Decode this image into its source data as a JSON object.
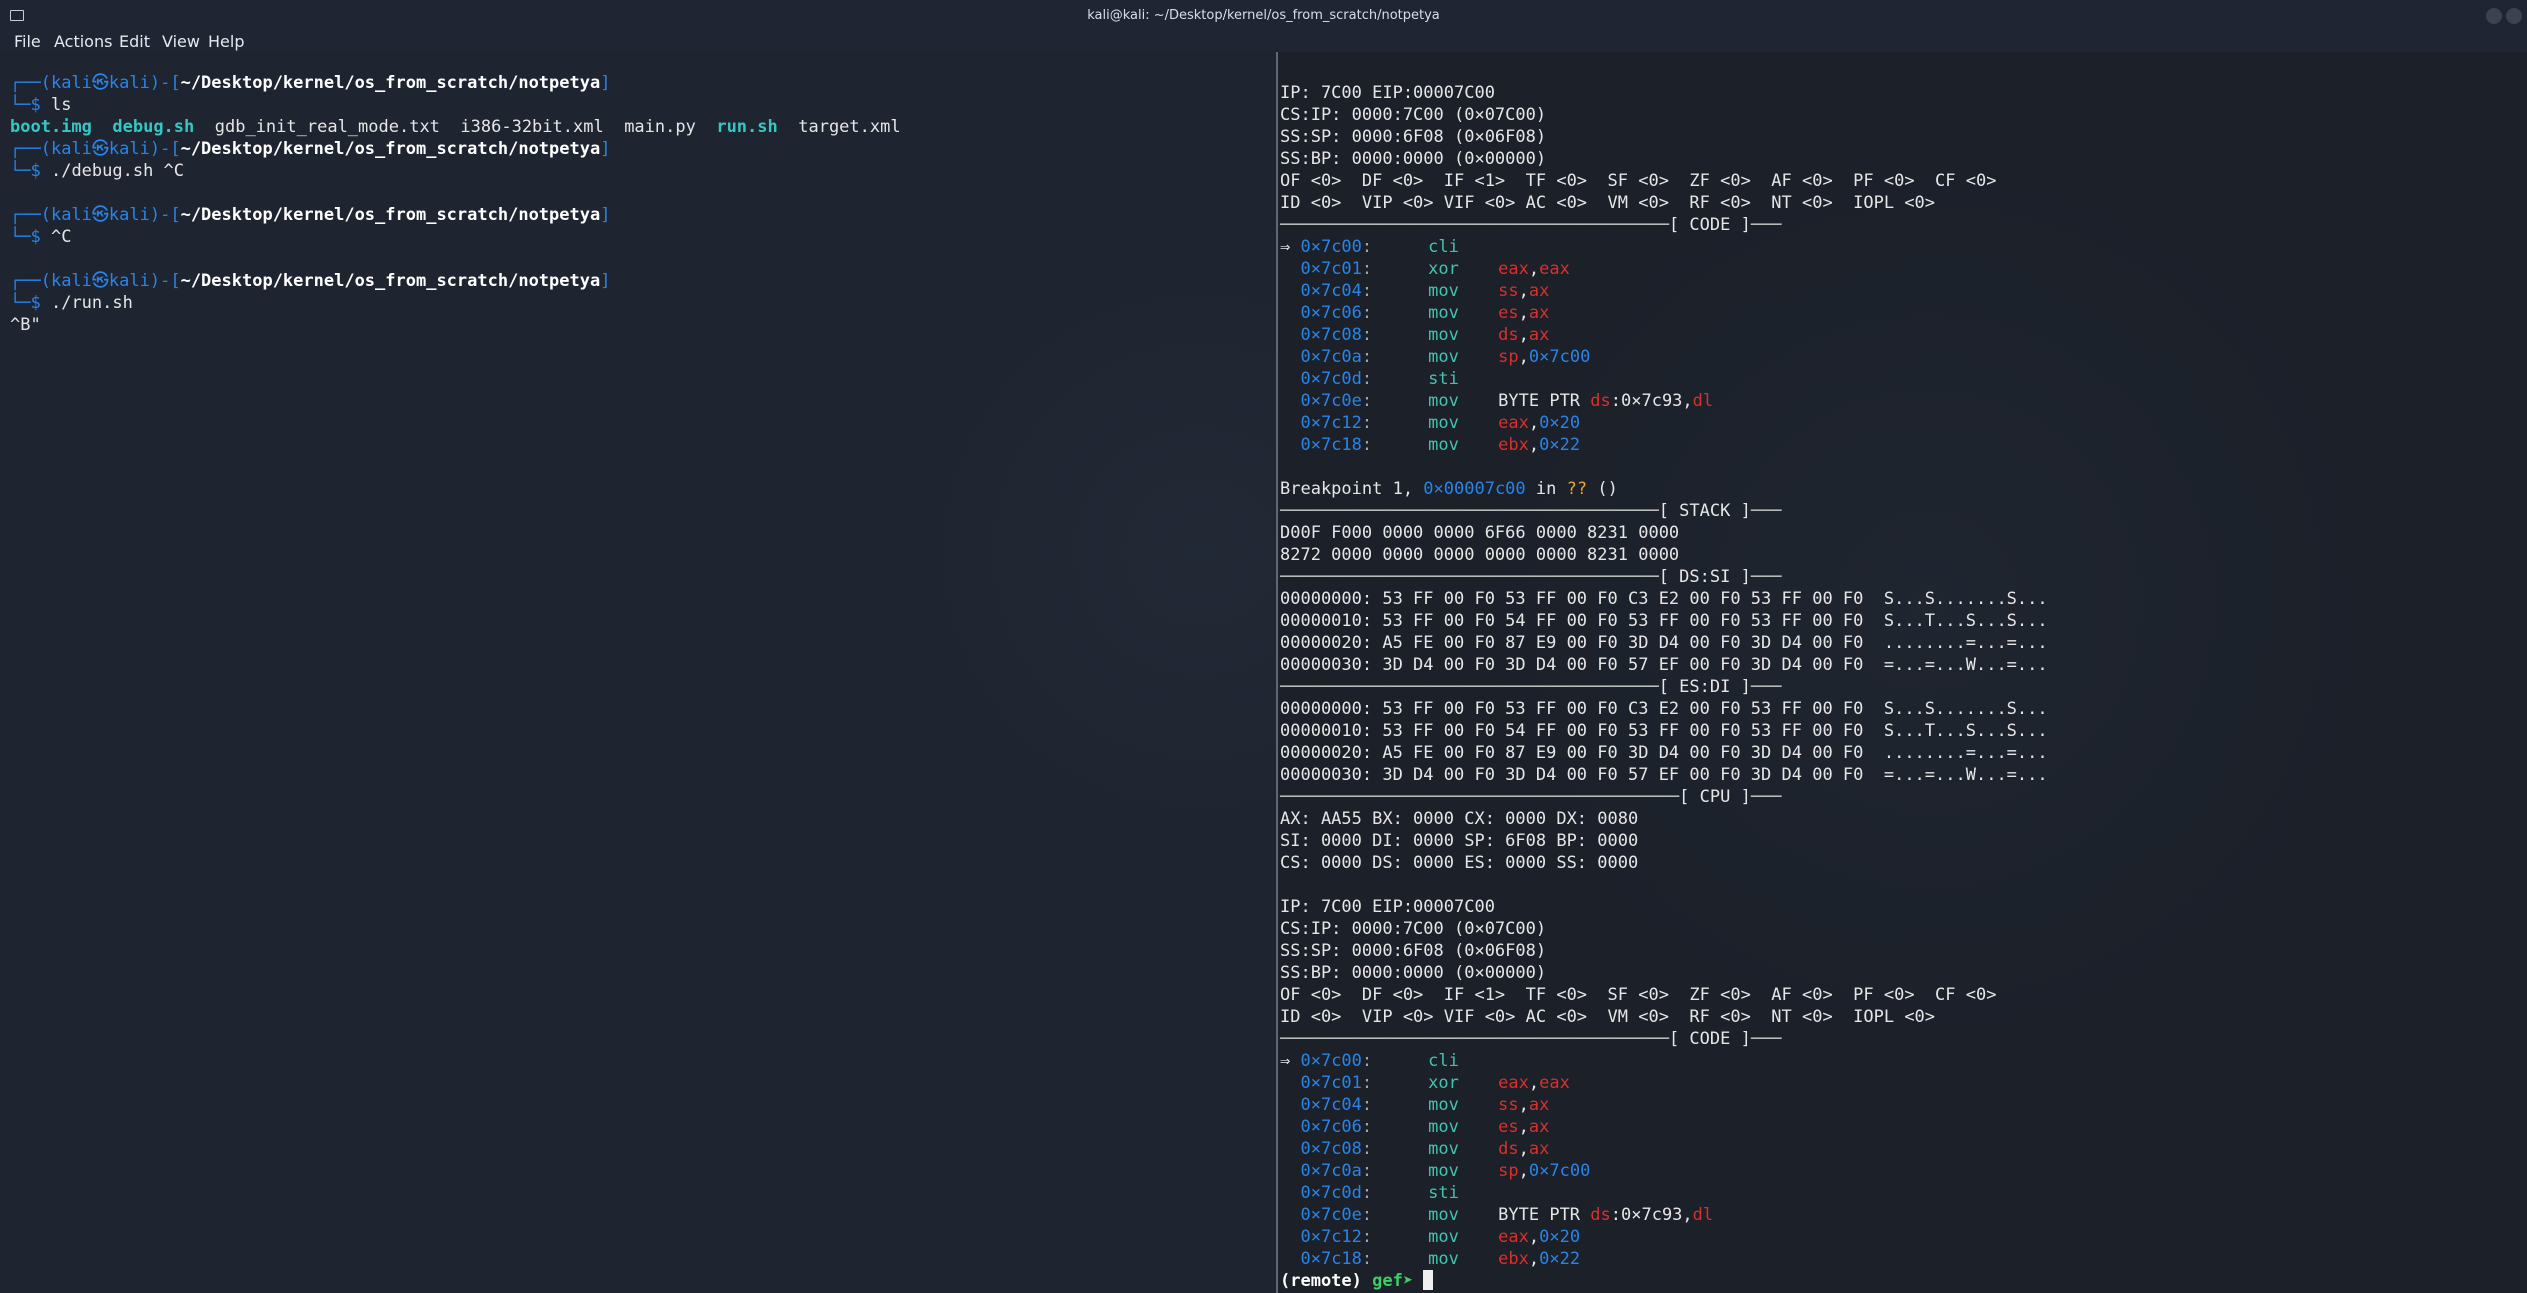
{
  "window": {
    "title": "kali@kali: ~/Desktop/kernel/os_from_scratch/notpetya"
  },
  "menu": [
    "File",
    "Actions",
    "Edit",
    "View",
    "Help"
  ],
  "left": {
    "prompt_user": "kali",
    "prompt_host": "kali",
    "prompt_at": "㉿",
    "prompt_path": "~/Desktop/kernel/os_from_scratch/notpetya",
    "blocks": [
      {
        "cmd": "ls"
      },
      {
        "cmd": "./debug.sh ^C"
      },
      {
        "cmd": "^C"
      },
      {
        "cmd": "./run.sh"
      }
    ],
    "ls_output": [
      {
        "name": "boot.img",
        "kind": "exec"
      },
      {
        "name": "debug.sh",
        "kind": "exec"
      },
      {
        "name": "gdb_init_real_mode.txt",
        "kind": "file"
      },
      {
        "name": "i386-32bit.xml",
        "kind": "file"
      },
      {
        "name": "main.py",
        "kind": "file"
      },
      {
        "name": "run.sh",
        "kind": "exec"
      },
      {
        "name": "target.xml",
        "kind": "file"
      }
    ],
    "run_output": "^B\""
  },
  "right": {
    "regs": {
      "ip": "IP: 7C00 EIP:00007C00",
      "csip": "CS:IP: 0000:7C00 (0×07C00)",
      "sssp": "SS:SP: 0000:6F08 (0×06F08)",
      "ssbp": "SS:BP: 0000:0000 (0×00000)",
      "flags1": "OF <0>  DF <0>  IF <1>  TF <0>  SF <0>  ZF <0>  AF <0>  PF <0>  CF <0>",
      "flags2": "ID <0>  VIP <0> VIF <0> AC <0>  VM <0>  RF <0>  NT <0>  IOPL <0>"
    },
    "headers": {
      "code": "[ CODE ]",
      "stack": "[ STACK ]",
      "dssi": "[ DS:SI ]",
      "esdi": "[ ES:DI ]",
      "cpu": "[ CPU ]"
    },
    "code": [
      {
        "arrow": "⇒ ",
        "addr": "0×7c00",
        "mn": "cli",
        "ops": []
      },
      {
        "arrow": "  ",
        "addr": "0×7c01",
        "mn": "xor",
        "ops": [
          {
            "t": "eax",
            "k": "reg"
          },
          {
            "t": ",",
            "k": "plain"
          },
          {
            "t": "eax",
            "k": "reg"
          }
        ]
      },
      {
        "arrow": "  ",
        "addr": "0×7c04",
        "mn": "mov",
        "ops": [
          {
            "t": "ss",
            "k": "reg"
          },
          {
            "t": ",",
            "k": "plain"
          },
          {
            "t": "ax",
            "k": "reg"
          }
        ]
      },
      {
        "arrow": "  ",
        "addr": "0×7c06",
        "mn": "mov",
        "ops": [
          {
            "t": "es",
            "k": "reg"
          },
          {
            "t": ",",
            "k": "plain"
          },
          {
            "t": "ax",
            "k": "reg"
          }
        ]
      },
      {
        "arrow": "  ",
        "addr": "0×7c08",
        "mn": "mov",
        "ops": [
          {
            "t": "ds",
            "k": "reg"
          },
          {
            "t": ",",
            "k": "plain"
          },
          {
            "t": "ax",
            "k": "reg"
          }
        ]
      },
      {
        "arrow": "  ",
        "addr": "0×7c0a",
        "mn": "mov",
        "ops": [
          {
            "t": "sp",
            "k": "reg"
          },
          {
            "t": ",",
            "k": "plain"
          },
          {
            "t": "0×7c00",
            "k": "num"
          }
        ]
      },
      {
        "arrow": "  ",
        "addr": "0×7c0d",
        "mn": "sti",
        "ops": []
      },
      {
        "arrow": "  ",
        "addr": "0×7c0e",
        "mn": "mov",
        "ops": [
          {
            "t": "BYTE PTR ",
            "k": "plain"
          },
          {
            "t": "ds",
            "k": "reg"
          },
          {
            "t": ":0×7c93,",
            "k": "plain"
          },
          {
            "t": "dl",
            "k": "reg"
          }
        ]
      },
      {
        "arrow": "  ",
        "addr": "0×7c12",
        "mn": "mov",
        "ops": [
          {
            "t": "eax",
            "k": "reg"
          },
          {
            "t": ",",
            "k": "plain"
          },
          {
            "t": "0×20",
            "k": "num"
          }
        ]
      },
      {
        "arrow": "  ",
        "addr": "0×7c18",
        "mn": "mov",
        "ops": [
          {
            "t": "ebx",
            "k": "reg"
          },
          {
            "t": ",",
            "k": "plain"
          },
          {
            "t": "0×22",
            "k": "num"
          }
        ]
      }
    ],
    "breakpoint": {
      "prefix": "Breakpoint 1, ",
      "addr": "0×00007c00",
      "mid": " in ",
      "func": "??",
      "suffix": " ()"
    },
    "stack": [
      "D00F F000 0000 0000 6F66 0000 8231 0000",
      "8272 0000 0000 0000 0000 0000 8231 0000"
    ],
    "dssi": [
      "00000000: 53 FF 00 F0 53 FF 00 F0 C3 E2 00 F0 53 FF 00 F0  S...S.......S...",
      "00000010: 53 FF 00 F0 54 FF 00 F0 53 FF 00 F0 53 FF 00 F0  S...T...S...S...",
      "00000020: A5 FE 00 F0 87 E9 00 F0 3D D4 00 F0 3D D4 00 F0  ........=...=...",
      "00000030: 3D D4 00 F0 3D D4 00 F0 57 EF 00 F0 3D D4 00 F0  =...=...W...=..."
    ],
    "esdi": [
      "00000000: 53 FF 00 F0 53 FF 00 F0 C3 E2 00 F0 53 FF 00 F0  S...S.......S...",
      "00000010: 53 FF 00 F0 54 FF 00 F0 53 FF 00 F0 53 FF 00 F0  S...T...S...S...",
      "00000020: A5 FE 00 F0 87 E9 00 F0 3D D4 00 F0 3D D4 00 F0  ........=...=...",
      "00000030: 3D D4 00 F0 3D D4 00 F0 57 EF 00 F0 3D D4 00 F0  =...=...W...=..."
    ],
    "cpu": [
      "AX: AA55 BX: 0000 CX: 0000 DX: 0080",
      "SI: 0000 DI: 0000 SP: 6F08 BP: 0000",
      "CS: 0000 DS: 0000 ES: 0000 SS: 0000"
    ],
    "prompt": {
      "remote": "(remote) ",
      "gef": "gef➤ "
    }
  },
  "colors": {
    "prompt_blue": "#2a84e8",
    "exec_teal": "#35c7c3",
    "reg_red": "#d9302c",
    "gef_green": "#3ecf68"
  }
}
